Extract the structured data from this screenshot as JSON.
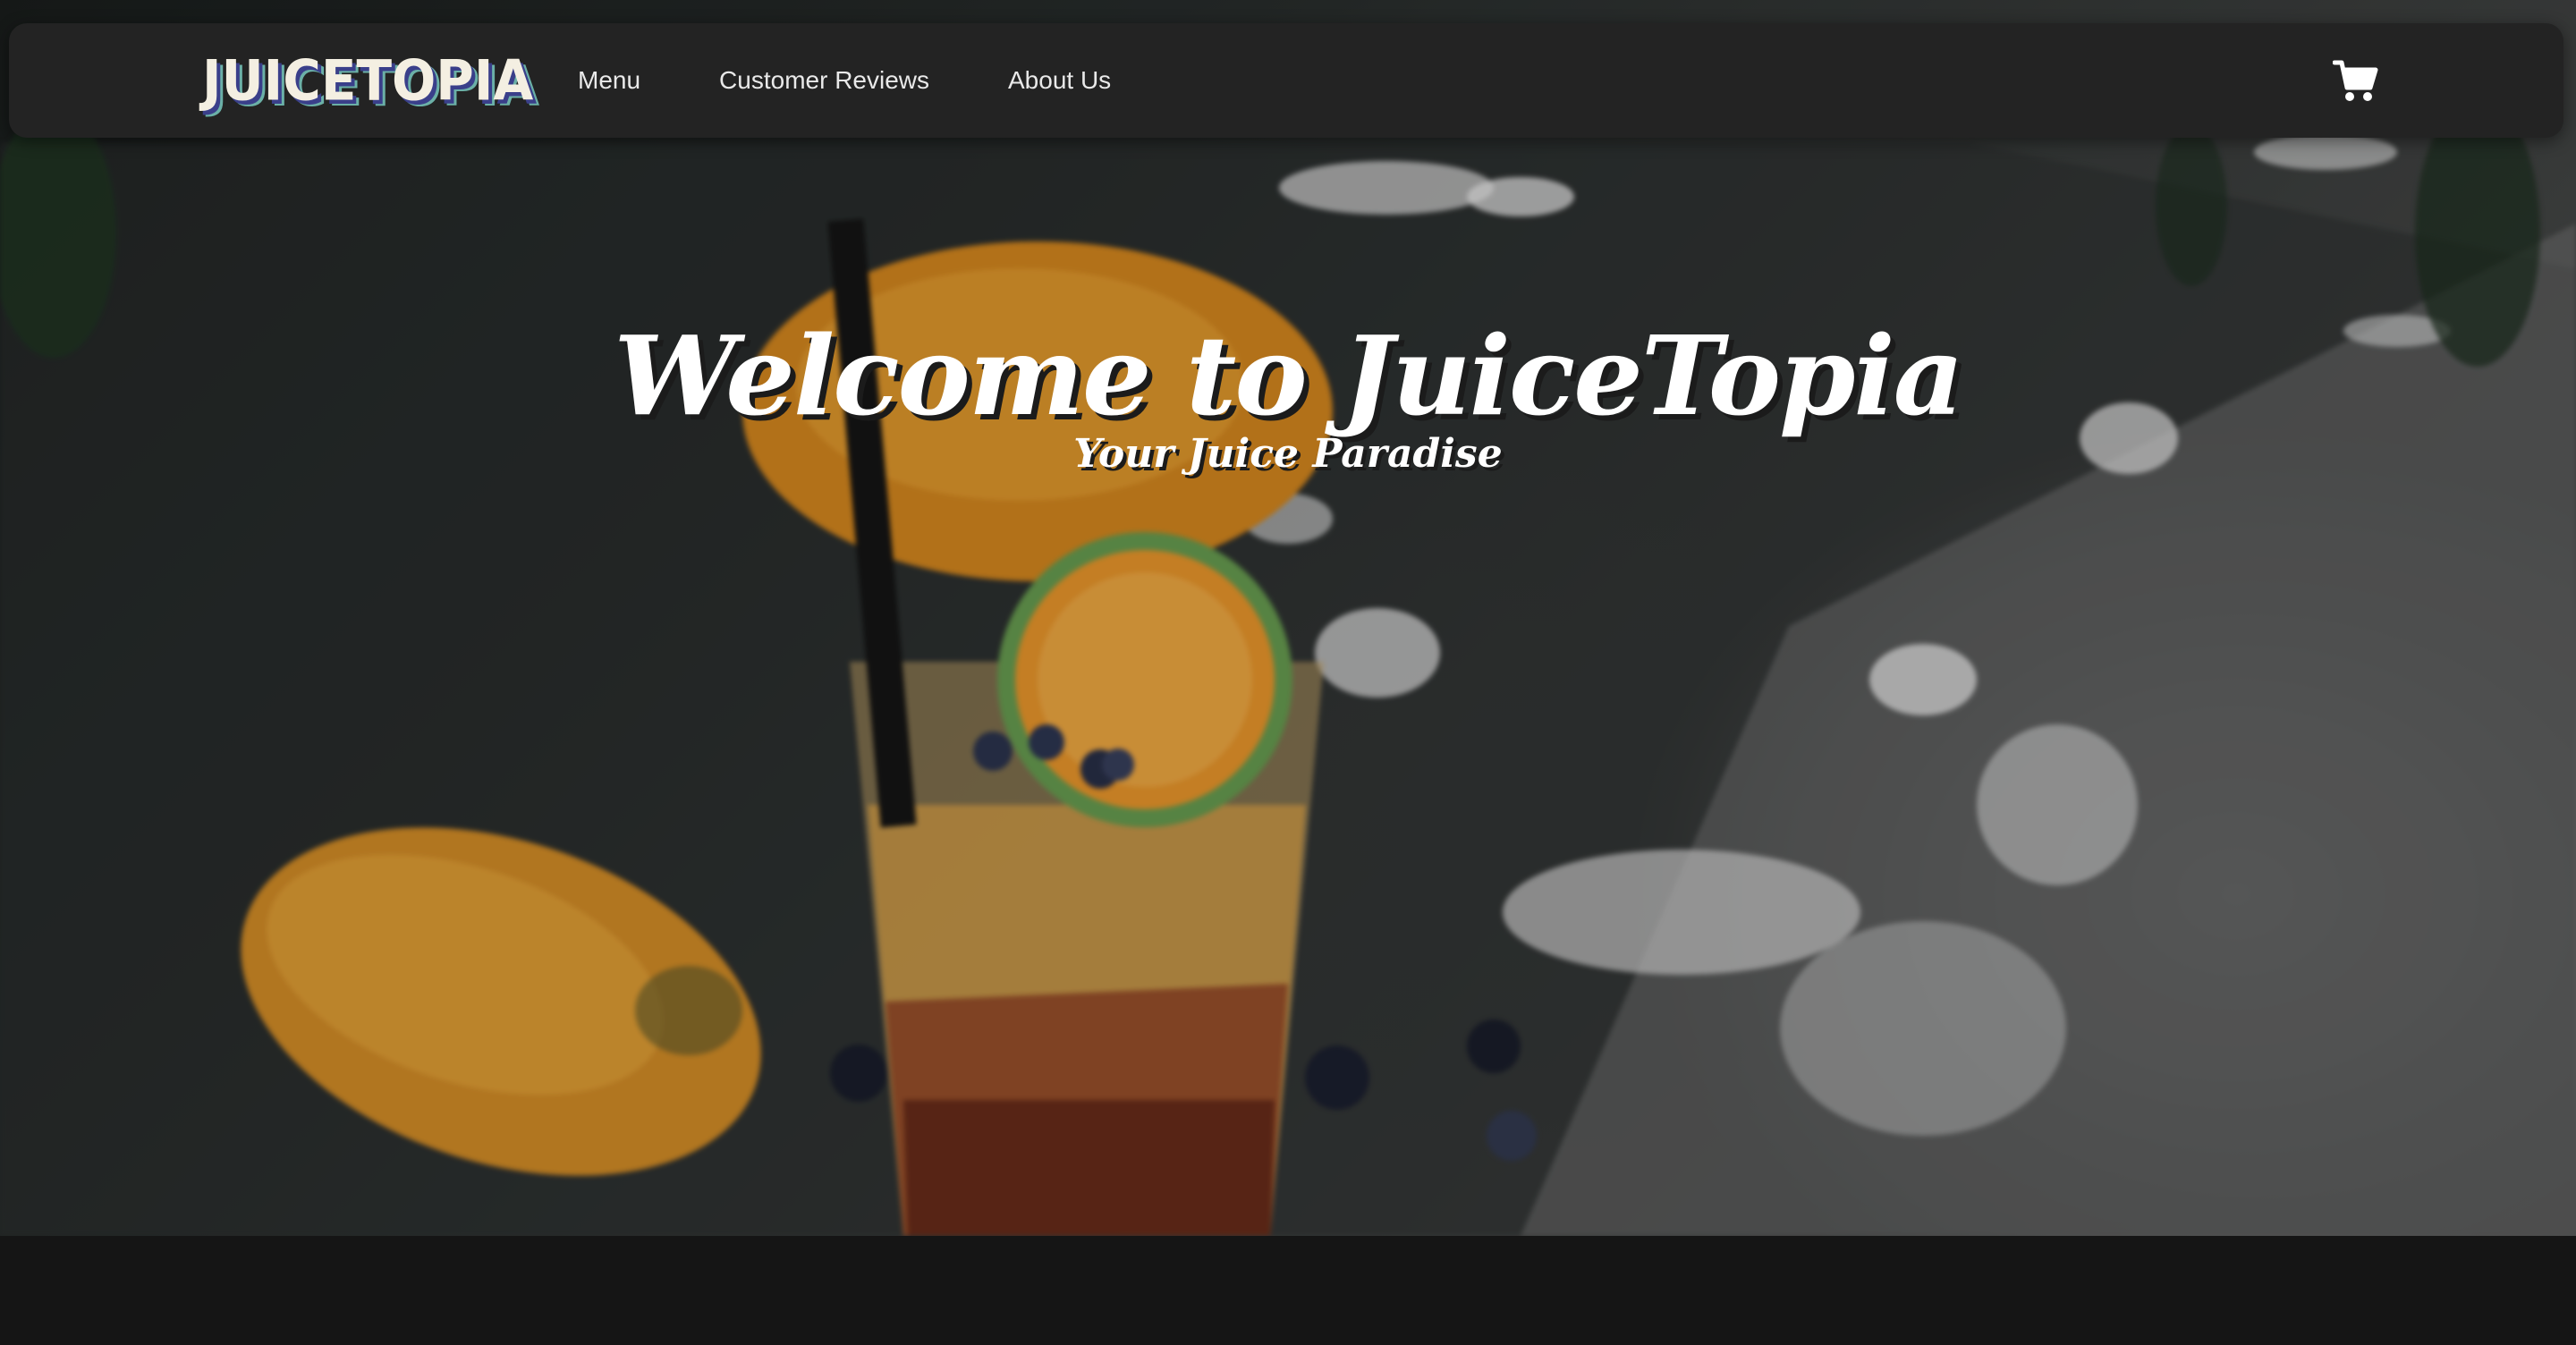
{
  "navbar": {
    "brand": "JUICETOPIA",
    "links": [
      {
        "label": "Menu"
      },
      {
        "label": "Customer Reviews"
      },
      {
        "label": "About Us"
      }
    ],
    "cart_icon": "shopping-cart-icon"
  },
  "hero": {
    "title": "Welcome to JuiceTopia",
    "subtitle": "Your Juice Paradise",
    "background_image": "juice-glass-with-mangoes-photo"
  },
  "colors": {
    "navbar_bg": "#232323",
    "page_bg": "#151515",
    "text": "#ffffff",
    "accent_orange": "#e8a02a"
  }
}
